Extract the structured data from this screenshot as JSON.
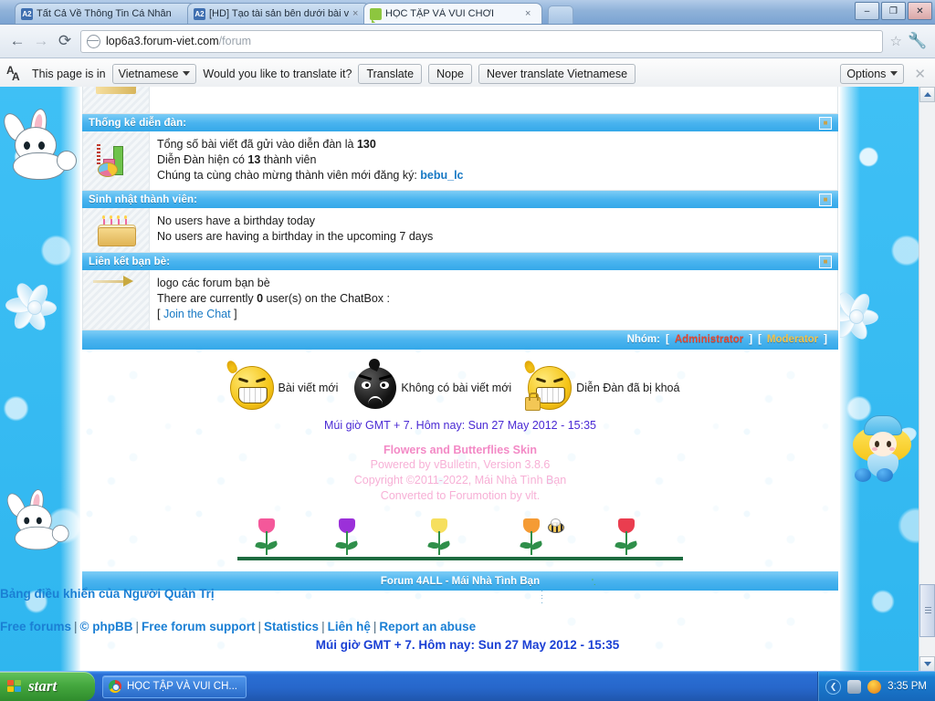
{
  "browser": {
    "tabs": [
      {
        "title": "Tất Cả Về Thông Tin Cá Nhân",
        "favicon": "a2-icon",
        "active": false
      },
      {
        "title": "[HD] Tạo tài sản bên dưới bài v",
        "favicon": "a2-icon",
        "active": false
      },
      {
        "title": "HỌC TẬP VÀ VUI CHƠI",
        "favicon": "chat-bubble-icon",
        "active": true
      }
    ],
    "tab_close_label": "×",
    "window_controls": {
      "minimize": "–",
      "maximize": "❐",
      "close": "✕"
    },
    "nav": {
      "back": "←",
      "forward": "→",
      "reload": "⟳"
    },
    "omnibox": {
      "url_domain": "lop6a3.forum-viet.com",
      "url_path": "/forum",
      "bookmark_star": "☆"
    },
    "tools_icon": "🔧"
  },
  "translate_bar": {
    "icon_a": "A",
    "icon_b": "A",
    "message_prefix": "This page is in",
    "language": "Vietnamese",
    "message_suffix": "Would you like to translate it?",
    "translate_label": "Translate",
    "nope_label": "Nope",
    "never_label": "Never translate Vietnamese",
    "options_label": "Options",
    "close_label": "✕"
  },
  "forum": {
    "sections": [
      {
        "title": "Thống kê diễn đàn:",
        "icon": "statistics-chart-icon",
        "lines": [
          {
            "parts": [
              {
                "t": "Tổng số bài viết đã gửi vào diễn đàn là ",
                "style": "normal"
              },
              {
                "t": "130",
                "style": "bold"
              }
            ]
          },
          {
            "parts": [
              {
                "t": "Diễn Đàn hiện có ",
                "style": "normal"
              },
              {
                "t": "13",
                "style": "bold"
              },
              {
                "t": " thành viên",
                "style": "normal"
              }
            ]
          },
          {
            "parts": [
              {
                "t": "Chúng ta cùng chào mừng thành viên mới đăng ký: ",
                "style": "normal"
              },
              {
                "t": "bebu_lc",
                "style": "link"
              }
            ]
          }
        ]
      },
      {
        "title": "Sinh nhật thành viên:",
        "icon": "birthday-cake-icon",
        "lines": [
          {
            "parts": [
              {
                "t": "No users have a birthday today",
                "style": "normal"
              }
            ]
          },
          {
            "parts": [
              {
                "t": "No users are having a birthday in the upcoming 7 days",
                "style": "normal"
              }
            ]
          }
        ]
      },
      {
        "title": "Liên kết bạn bè:",
        "icon": "arrow-banner-icon",
        "lines": [
          {
            "parts": [
              {
                "t": "logo các forum bạn bè",
                "style": "normal"
              }
            ]
          },
          {
            "parts": [
              {
                "t": "There are currently ",
                "style": "normal"
              },
              {
                "t": "0",
                "style": "bold"
              },
              {
                "t": " user(s) on the ChatBox :",
                "style": "normal"
              }
            ]
          },
          {
            "parts": [
              {
                "t": "[ ",
                "style": "normal"
              },
              {
                "t": "Join the Chat",
                "style": "link-plain"
              },
              {
                "t": " ]",
                "style": "normal"
              }
            ]
          }
        ]
      }
    ],
    "groups_bar": {
      "label": "Nhóm:",
      "open_bracket": "[",
      "close_bracket": "]",
      "administrator": "Administrator",
      "moderator": "Moderator"
    },
    "legend": [
      {
        "label": "Bài viết mới",
        "icon": "smiley-new-posts-icon"
      },
      {
        "label": "Không có bài viết mới",
        "icon": "bomb-no-new-posts-icon"
      },
      {
        "label": "Diễn Đàn đã bị khoá",
        "icon": "smiley-locked-forum-icon"
      }
    ],
    "timezone_line": "Múi giờ GMT + 7. Hôm nay: Sun 27 May 2012 - 15:35",
    "credits": {
      "skin": "Flowers and Butterflies Skin",
      "powered": "Powered by vBulletin, Version 3.8.6",
      "copyright": "Copyright ©2011-2022, Mái Nhà Tình Bạn",
      "converted": "Converted to Forumotion by vlt."
    },
    "flowers": {
      "colors": [
        "#f4589a",
        "#9b30d9",
        "#f6df5e",
        "#f59b34",
        "#ea3d4f"
      ],
      "bee_icon": "bee-icon"
    },
    "site_bar": "Forum 4ALL - Mái Nhà Tình Bạn"
  },
  "footer": {
    "admin_panel_link": "Bảng điều khiển của Người Quản Trị",
    "links": [
      "Free forums",
      "© phpBB",
      "Free forum support",
      "Statistics",
      "Liên hệ",
      "Report an abuse"
    ],
    "separator": "|",
    "timezone_line": "Múi giờ GMT + 7. Hôm nay: Sun 27 May 2012 - 15:35"
  },
  "decorations": {
    "left_bunny_top": "bunny-icon",
    "left_bunny_bottom": "bunny-icon",
    "left_flower": "daisy-flower-icon",
    "right_fairy": "fairy-girl-icon",
    "right_flower": "daisy-flower-icon"
  },
  "scrollbar": {
    "up_arrow": "▲",
    "down_arrow": "▼"
  },
  "taskbar": {
    "start_label": "start",
    "task_title": "HỌC TẬP VÀ VUI CH...",
    "tray_chevron": "❮",
    "clock": "3:35 PM"
  },
  "colors": {
    "accent_blue": "#34a8e9",
    "link_blue": "#1879c4",
    "admin_red": "#e8452c",
    "mod_gold": "#f2c14a",
    "credit_pink": "#f7b0d6",
    "tz_purple": "#4a2ad4"
  }
}
